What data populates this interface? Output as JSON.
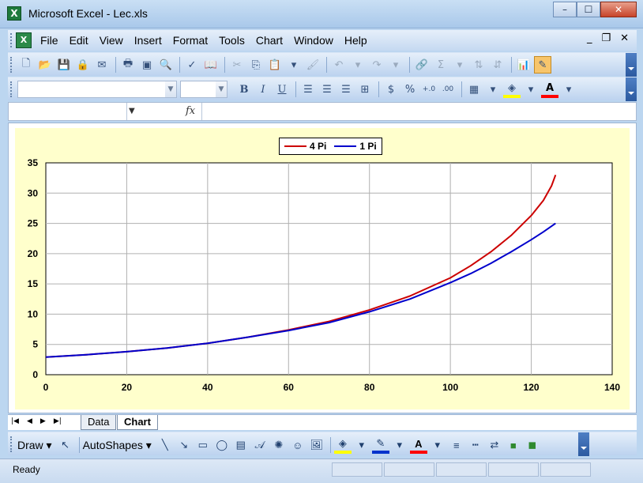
{
  "window": {
    "title": "Microsoft Excel - Lec.xls",
    "app_icon_letter": "X"
  },
  "menu": {
    "items": [
      "File",
      "Edit",
      "View",
      "Insert",
      "Format",
      "Tools",
      "Chart",
      "Window",
      "Help"
    ]
  },
  "formula_bar": {
    "fx_label": "fx"
  },
  "toolbar2": {
    "bold_label": "B",
    "italic_label": "I",
    "underline_label": "U",
    "currency_label": "$",
    "percent_label": "%"
  },
  "chart_data": {
    "type": "line",
    "xlim": [
      0,
      140
    ],
    "ylim": [
      0,
      35
    ],
    "xticks": [
      0,
      20,
      40,
      60,
      80,
      100,
      120,
      140
    ],
    "yticks": [
      0,
      5,
      10,
      15,
      20,
      25,
      30,
      35
    ],
    "grid": true,
    "legend_position": "top-center",
    "series": [
      {
        "name": "4 Pi",
        "color": "#cc0000",
        "x": [
          0,
          10,
          20,
          30,
          40,
          50,
          60,
          70,
          80,
          90,
          100,
          105,
          110,
          115,
          120,
          123,
          125,
          126
        ],
        "y": [
          2.9,
          3.3,
          3.8,
          4.4,
          5.2,
          6.2,
          7.4,
          8.8,
          10.7,
          13.0,
          16.0,
          18.0,
          20.3,
          23.0,
          26.3,
          28.8,
          31.2,
          33.0
        ]
      },
      {
        "name": "1 Pi",
        "color": "#0000cc",
        "x": [
          0,
          10,
          20,
          30,
          40,
          50,
          60,
          70,
          80,
          90,
          100,
          105,
          110,
          115,
          120,
          123,
          126
        ],
        "y": [
          2.9,
          3.3,
          3.8,
          4.4,
          5.2,
          6.2,
          7.3,
          8.6,
          10.4,
          12.5,
          15.2,
          16.7,
          18.4,
          20.3,
          22.3,
          23.6,
          25.0
        ]
      }
    ]
  },
  "sheet_tabs": {
    "items": [
      "Data",
      "Chart"
    ],
    "active": "Chart"
  },
  "drawing_toolbar": {
    "draw_label": "Draw",
    "autoshapes_label": "AutoShapes"
  },
  "status": {
    "text": "Ready"
  },
  "window_controls": {
    "minimize": "–",
    "restore": "☐",
    "close": "✕"
  }
}
